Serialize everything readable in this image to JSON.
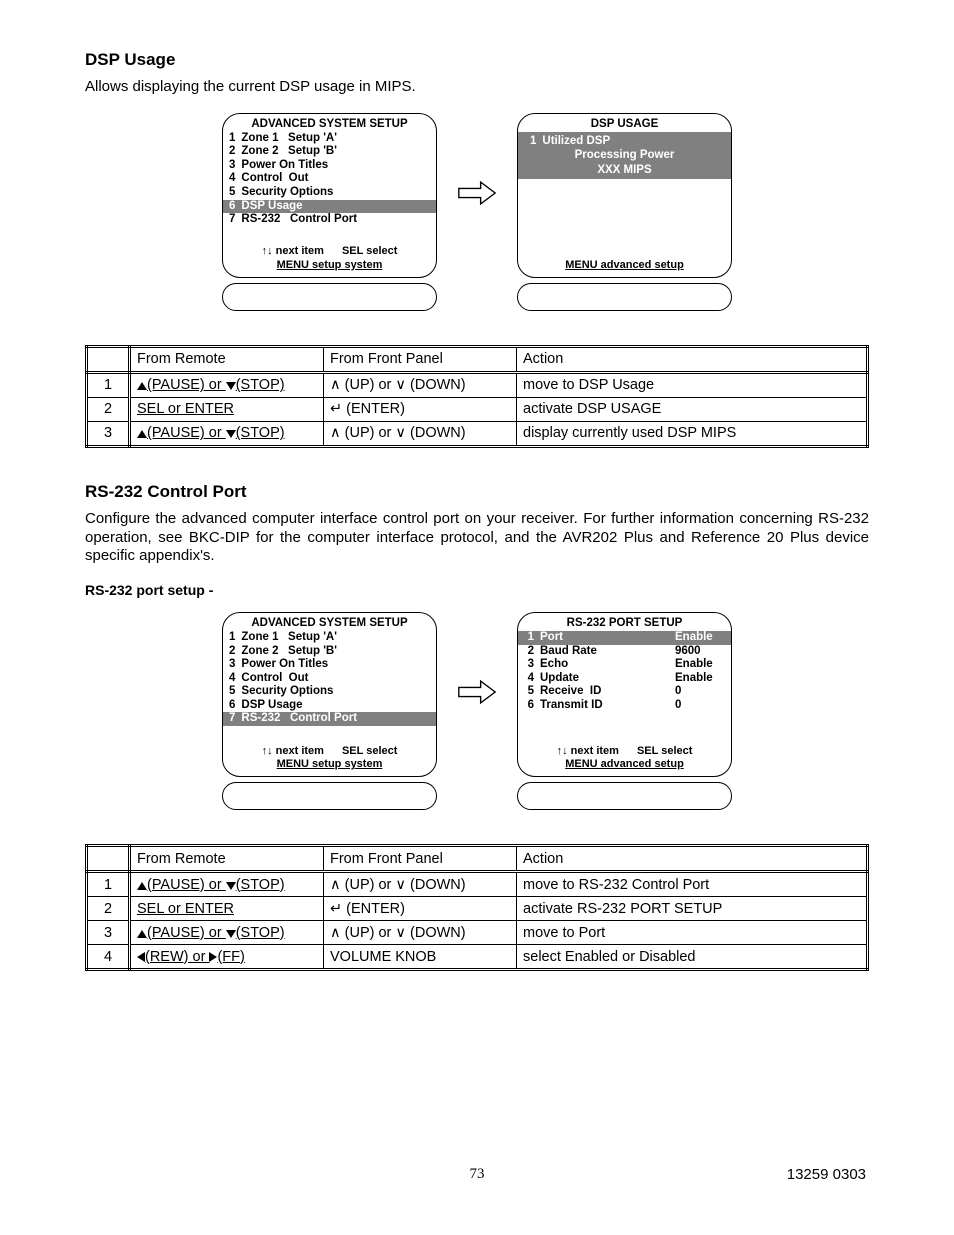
{
  "sec1": {
    "heading": "DSP Usage",
    "para": "Allows displaying the current DSP usage in MIPS."
  },
  "menuA": {
    "title": "ADVANCED SYSTEM SETUP",
    "items": [
      {
        "n": "1",
        "label": "Zone 1   Setup 'A'"
      },
      {
        "n": "2",
        "label": "Zone 2   Setup 'B'"
      },
      {
        "n": "3",
        "label": "Power On Titles"
      },
      {
        "n": "4",
        "label": "Control  Out"
      },
      {
        "n": "5",
        "label": "Security Options"
      },
      {
        "n": "6",
        "label": "DSP Usage",
        "sel": true
      },
      {
        "n": "7",
        "label": "RS-232   Control Port"
      }
    ],
    "footer": {
      "l1a": "↑↓   next item",
      "l1b": "SEL  select",
      "l2": "MENU setup system"
    }
  },
  "menuB": {
    "title": "DSP USAGE",
    "info": {
      "n": "1",
      "l1": "Utilized DSP",
      "l2": "Processing Power",
      "l3": "XXX MIPS"
    },
    "footer": {
      "l2": "MENU  advanced setup"
    }
  },
  "table1": {
    "headers": [
      "",
      "From Remote",
      "From Front Panel",
      "Action"
    ],
    "rows": [
      {
        "n": "1",
        "remote": {
          "a": "(PAUSE)",
          "b": "(STOP)",
          "type": "updown"
        },
        "front": "∧ (UP) or ∨ (DOWN)",
        "action": "move to DSP Usage"
      },
      {
        "n": "2",
        "remote": {
          "text": "SEL or ENTER"
        },
        "front": "↵ (ENTER)",
        "action": "activate DSP USAGE"
      },
      {
        "n": "3",
        "remote": {
          "a": "(PAUSE)",
          "b": "(STOP)",
          "type": "updown"
        },
        "front": "∧ (UP) or ∨ (DOWN)",
        "action": "display currently used DSP MIPS"
      }
    ]
  },
  "sec2": {
    "heading": "RS-232 Control Port",
    "para": "Configure the advanced computer interface control port on your receiver. For further information concerning RS-232 operation, see BKC-DIP for the computer interface protocol, and the AVR202 Plus and Reference 20 Plus device specific appendix's.",
    "sub": "RS-232 port setup -"
  },
  "menuC": {
    "title": "ADVANCED SYSTEM SETUP",
    "items": [
      {
        "n": "1",
        "label": "Zone 1   Setup 'A'"
      },
      {
        "n": "2",
        "label": "Zone 2   Setup 'B'"
      },
      {
        "n": "3",
        "label": "Power On Titles"
      },
      {
        "n": "4",
        "label": "Control  Out"
      },
      {
        "n": "5",
        "label": "Security Options"
      },
      {
        "n": "6",
        "label": "DSP Usage"
      },
      {
        "n": "7",
        "label": "RS-232   Control Port",
        "sel": true
      }
    ],
    "footer": {
      "l1a": "↑↓   next item",
      "l1b": "SEL  select",
      "l2": "MENU setup system"
    }
  },
  "menuD": {
    "title": "RS-232 PORT SETUP",
    "items": [
      {
        "n": "1",
        "label": "Port",
        "val": "Enable",
        "sel": true
      },
      {
        "n": "2",
        "label": "Baud Rate",
        "val": "9600"
      },
      {
        "n": "3",
        "label": "Echo",
        "val": "Enable"
      },
      {
        "n": "4",
        "label": "Update",
        "val": "Enable"
      },
      {
        "n": "5",
        "label": "Receive  ID",
        "val": "0"
      },
      {
        "n": "6",
        "label": "Transmit ID",
        "val": "0"
      }
    ],
    "footer": {
      "l1a": "↑↓  next item",
      "l1b": "SEL  select",
      "l2": "MENU  advanced setup"
    }
  },
  "table2": {
    "headers": [
      "",
      "From Remote",
      "From Front Panel",
      "Action"
    ],
    "rows": [
      {
        "n": "1",
        "remote": {
          "a": "(PAUSE)",
          "b": "(STOP)",
          "type": "updown"
        },
        "front": "∧ (UP) or ∨ (DOWN)",
        "action": "move to RS-232 Control Port"
      },
      {
        "n": "2",
        "remote": {
          "text": "SEL or ENTER"
        },
        "front": "↵ (ENTER)",
        "action": "activate RS-232 PORT SETUP"
      },
      {
        "n": "3",
        "remote": {
          "a": "(PAUSE)",
          "b": "(STOP)",
          "type": "updown"
        },
        "front": "∧ (UP) or ∨ (DOWN)",
        "action": "move to Port"
      },
      {
        "n": "4",
        "remote": {
          "a": "(REW)",
          "b": "(FF)",
          "type": "leftright"
        },
        "front": "VOLUME KNOB",
        "action": "select Enabled or Disabled"
      }
    ]
  },
  "footer": {
    "page": "73",
    "doc": "13259 0303"
  }
}
